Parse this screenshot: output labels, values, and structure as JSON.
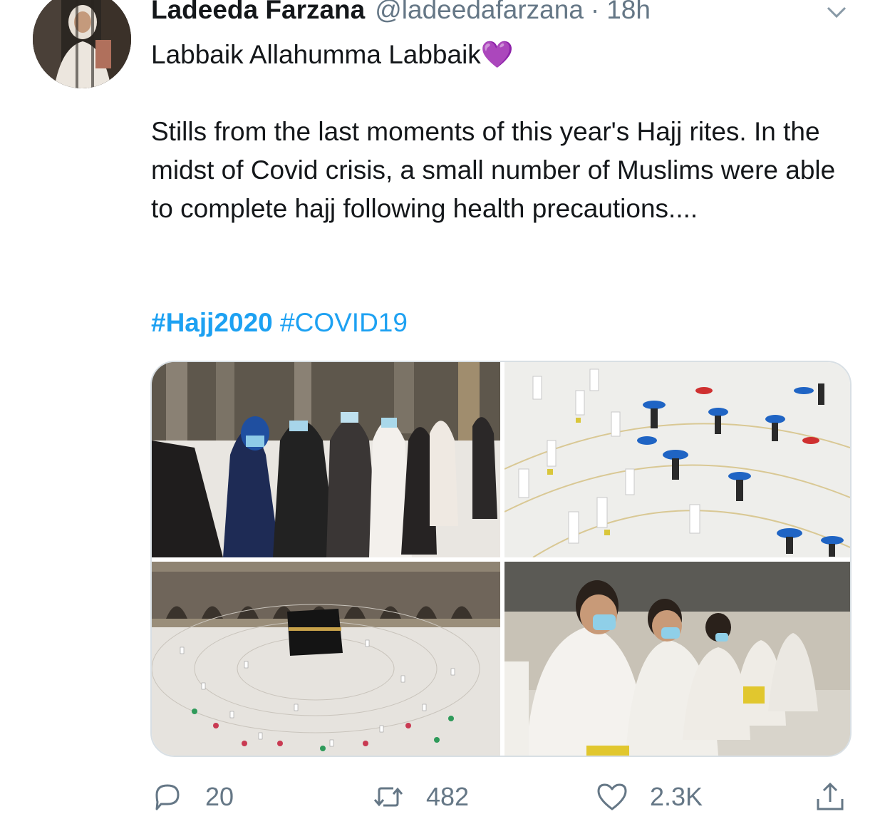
{
  "tweet": {
    "display_name": "Ladeeda Farzana",
    "handle": "@ladeedafarzana",
    "separator": "·",
    "time": "18h",
    "line1": "Labbaik Allahumma Labbaik💜",
    "body": "Stills from the last moments of this year's Hajj rites. In the midst of Covid crisis, a small number of Muslims were able to complete hajj following health precautions....",
    "hashtags": [
      "#Hajj2020",
      "#COVID19"
    ]
  },
  "actions": {
    "replies": "20",
    "retweets": "482",
    "likes": "2.3K"
  },
  "colors": {
    "text": "#14171a",
    "secondary": "#657786",
    "link": "#1da1f2",
    "border": "#d8dfe4"
  },
  "icons": [
    "chevron-down-icon",
    "reply-icon",
    "retweet-icon",
    "like-icon",
    "share-icon"
  ]
}
